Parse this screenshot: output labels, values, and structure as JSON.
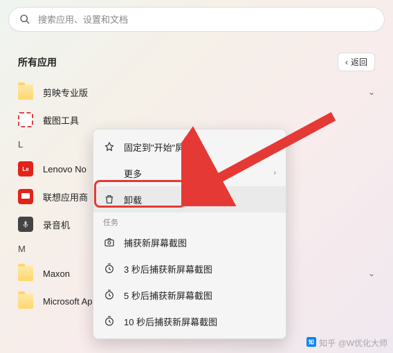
{
  "search": {
    "placeholder": "搜索应用、设置和文档"
  },
  "header": {
    "title": "所有应用",
    "back": "返回"
  },
  "apps": {
    "jianying": "剪映专业版",
    "jietu": "截图工具",
    "lenovo": "Lenovo No",
    "lenovostore": "联想应用商",
    "luyinji": "录音机",
    "maxon": "Maxon",
    "msapplocale": "Microsoft AppLocale"
  },
  "letters": {
    "L": "L",
    "M": "M"
  },
  "menu": {
    "pin": "固定到\"开始\"屏幕",
    "more": "更多",
    "uninstall": "卸载",
    "tasks_label": "任务",
    "task1": "捕获新屏幕截图",
    "task2": "3 秒后捕获新屏幕截图",
    "task3": "5 秒后捕获新屏幕截图",
    "task4": "10 秒后捕获新屏幕截图"
  },
  "watermark": {
    "text": "知乎 @W优化大师"
  }
}
